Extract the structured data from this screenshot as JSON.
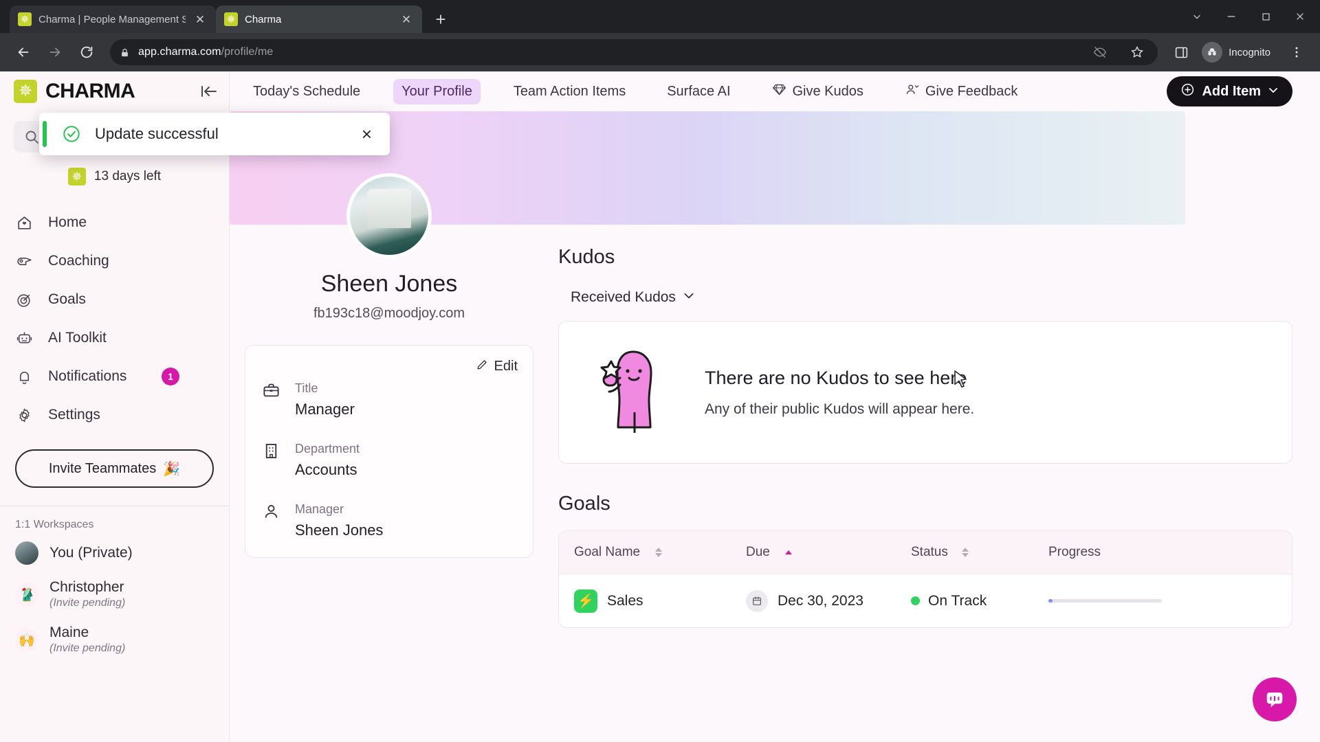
{
  "browser": {
    "tabs": [
      {
        "title": "Charma | People Management S",
        "favicon": "charma-star-icon",
        "active": false
      },
      {
        "title": "Charma",
        "favicon": "charma-star-icon",
        "active": true
      }
    ],
    "new_tab_label": "+",
    "url_host": "app.charma.com",
    "url_path": "/profile/me",
    "profile_label": "Incognito",
    "window_controls": [
      "chevron-down",
      "minimize",
      "maximize",
      "close"
    ]
  },
  "toast": {
    "message": "Update successful",
    "close_label": "×",
    "accent": "#23c552"
  },
  "sidebar": {
    "brand": "CHARMA",
    "collapse_label": "⇤",
    "search_placeholder": "",
    "trial": "13 days left",
    "items": [
      {
        "label": "Home",
        "icon": "home-icon",
        "badge": ""
      },
      {
        "label": "Coaching",
        "icon": "whistle-icon",
        "badge": ""
      },
      {
        "label": "Goals",
        "icon": "target-icon",
        "badge": ""
      },
      {
        "label": "AI Toolkit",
        "icon": "robot-icon",
        "badge": ""
      },
      {
        "label": "Notifications",
        "icon": "bell-icon",
        "badge": "1"
      },
      {
        "label": "Settings",
        "icon": "gear-icon",
        "badge": ""
      }
    ],
    "invite_label": "Invite Teammates",
    "invite_emoji": "🎉",
    "workspaces_title": "1:1 Workspaces",
    "workspaces": [
      {
        "name": "You (Private)",
        "status": "",
        "avatar": "photo"
      },
      {
        "name": "Christopher",
        "status": "(Invite pending)",
        "avatar": "🥻"
      },
      {
        "name": "Maine",
        "status": "(Invite pending)",
        "avatar": "🙌"
      }
    ]
  },
  "topnav": {
    "items": [
      {
        "label": "Today's Schedule",
        "icon": "",
        "active": false
      },
      {
        "label": "Your Profile",
        "icon": "",
        "active": true
      },
      {
        "label": "Team Action Items",
        "icon": "",
        "active": false
      },
      {
        "label": "Surface AI",
        "icon": "",
        "active": false
      },
      {
        "label": "Give Kudos",
        "icon": "gem-icon",
        "active": false
      },
      {
        "label": "Give Feedback",
        "icon": "person-feedback-icon",
        "active": false
      }
    ],
    "add_item_label": "Add Item"
  },
  "profile": {
    "name": "Sheen Jones",
    "email": "fb193c18@moodjoy.com",
    "edit_label": "Edit",
    "fields": [
      {
        "label": "Title",
        "value": "Manager",
        "icon": "briefcase-icon"
      },
      {
        "label": "Department",
        "value": "Accounts",
        "icon": "building-icon"
      },
      {
        "label": "Manager",
        "value": "Sheen Jones",
        "icon": "person-icon"
      }
    ]
  },
  "kudos": {
    "title": "Kudos",
    "filter": "Received Kudos",
    "empty_title": "There are no Kudos to see here",
    "empty_subtitle": "Any of their public Kudos will appear here."
  },
  "goals": {
    "title": "Goals",
    "columns": [
      "Goal Name",
      "Due",
      "Status",
      "Progress"
    ],
    "sort_column": "Due",
    "rows": [
      {
        "name": "Sales",
        "due": "Dec 30, 2023",
        "status": "On Track",
        "progress": "4",
        "status_color": "#2fd35e",
        "icon": "lightning-icon"
      }
    ]
  },
  "support": {
    "label": "chat-icon"
  }
}
